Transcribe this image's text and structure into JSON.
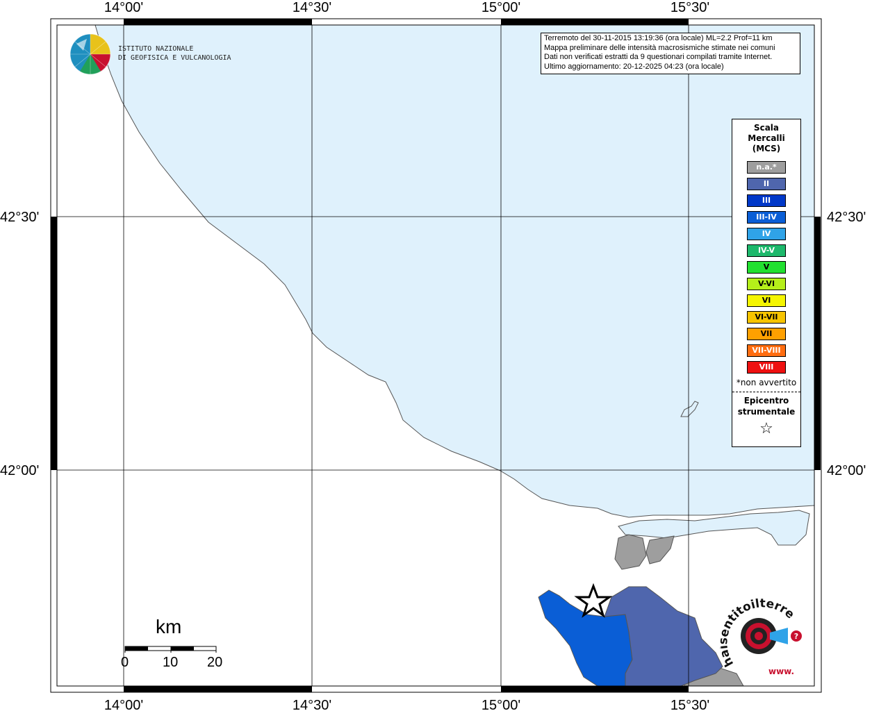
{
  "info_box": {
    "line1": "Terremoto del 30-11-2015 13:19:36 (ora locale) ML=2.2 Prof=11 km",
    "line2": "Mappa preliminare delle intensità macrosismiche stimate nei comuni",
    "line3": "Dati non verificati estratti da 9 questionari compilati tramite Internet.",
    "line4": "Ultimo aggiornamento: 20-12-2025 04:23 (ora locale)"
  },
  "logo": {
    "line1": "ISTITUTO NAZIONALE",
    "line2": "DI GEOFISICA E VULCANOLOGIA"
  },
  "legend": {
    "title_line1": "Scala",
    "title_line2": "Mercalli",
    "title_line3": "(MCS)",
    "items": [
      {
        "label": "n.a.*",
        "color": "#9e9e9e"
      },
      {
        "label": "II",
        "color": "#4f66ad"
      },
      {
        "label": "III",
        "color": "#0038c8"
      },
      {
        "label": "III-IV",
        "color": "#0a5ed6"
      },
      {
        "label": "IV",
        "color": "#2fa3e8"
      },
      {
        "label": "IV-V",
        "color": "#1db86b"
      },
      {
        "label": "V",
        "color": "#22e030"
      },
      {
        "label": "V-VI",
        "color": "#b5ef1a"
      },
      {
        "label": "VI",
        "color": "#f5f500"
      },
      {
        "label": "VI-VII",
        "color": "#f7c400"
      },
      {
        "label": "VII",
        "color": "#ffa000"
      },
      {
        "label": "VII-VIII",
        "color": "#ff6d10"
      },
      {
        "label": "VIII",
        "color": "#ee1010"
      }
    ],
    "note": "*non avvertito",
    "epicenter_line1": "Epicentro",
    "epicenter_line2": "strumentale",
    "star": "☆"
  },
  "map": {
    "sea_color": "#dff1fc",
    "land_color": "#ffffff",
    "longitude_ticks": [
      "14°00'",
      "14°30'",
      "15°00'",
      "15°30'"
    ],
    "latitude_ticks": [
      "42°30'",
      "42°00'"
    ],
    "municipalities": [
      {
        "intensity": "III-IV",
        "color": "#0a5ed6"
      },
      {
        "intensity": "II",
        "color": "#4f66ad"
      },
      {
        "intensity": "n.a.*",
        "color": "#9e9e9e"
      }
    ]
  },
  "scale_bar": {
    "unit": "km",
    "labels": [
      "0",
      "10",
      "20"
    ]
  },
  "brand_logo": {
    "text": "haisentitoilterremoto.it",
    "prefix": "www."
  }
}
